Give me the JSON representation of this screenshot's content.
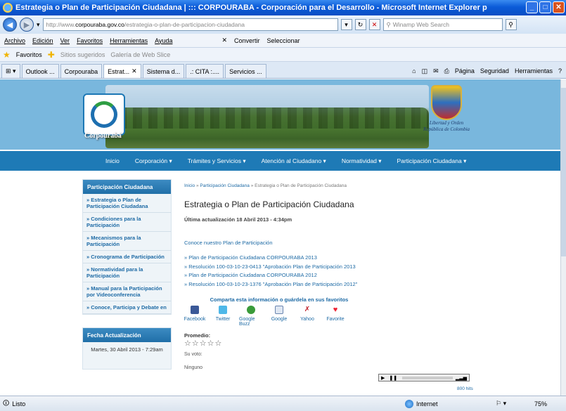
{
  "window": {
    "title": "Estrategia o Plan de Participación Ciudadana | ::: CORPOURABA - Corporación para el Desarrollo - Microsoft Internet Explorer p",
    "url_prefix": "http://www.",
    "url_domain": "corpouraba.gov.co",
    "url_path": "/estrategia-o-plan-de-participacion-ciudadana",
    "search_placeholder": "Winamp Web Search"
  },
  "menubar": [
    "Archivo",
    "Edición",
    "Ver",
    "Favoritos",
    "Herramientas",
    "Ayuda"
  ],
  "convert": {
    "convertir": "Convertir",
    "seleccionar": "Seleccionar"
  },
  "favbar": {
    "favoritos": "Favoritos",
    "sitios": "Sitios sugeridos",
    "galeria": "Galería de Web Slice"
  },
  "tabs": [
    "Outlook ...",
    "Corpouraba",
    "Estrat...",
    "Sistema d...",
    ".: CITA :....",
    "Servicios ..."
  ],
  "tools": [
    "Página",
    "Seguridad",
    "Herramientas"
  ],
  "site": {
    "logo_text": "Corpourabá",
    "shield_line1": "Libertad y Orden",
    "shield_line2": "República de Colombia",
    "nav": [
      "Inicio",
      "Corporación",
      "Trámites y Servicios",
      "Atención al Ciudadano",
      "Normatividad",
      "Participación Ciudadana"
    ]
  },
  "sidebar": {
    "title": "Participación Ciudadana",
    "items": [
      "Estrategia o Plan de Participación Ciudadana",
      "Condiciones para la Participación",
      "Mecanismos para la Participación",
      "Cronograma de Participación",
      "Normatividad para la Participación",
      "Manual para la Participación por Videoconferencia",
      "Conoce, Participa y Debate en"
    ],
    "date_title": "Fecha Actualización",
    "date_value": "Martes, 30 Abril 2013 - 7:29am"
  },
  "content": {
    "crumb_home": "Inicio",
    "crumb_mid": "Participación Ciudadana",
    "crumb_current": "Estrategia o Plan de Participación Ciudadana",
    "title": "Estrategia o Plan de Participación Ciudadana",
    "updated": "Última actualización 18 Abril 2013 - 4:34pm",
    "intro": "Conoce nuestro Plan de Participación",
    "links": [
      "Plan de Participación Ciudadana CORPOURABA 2013",
      "Resolución 100-03-10-23-0413 \"Aprobación Plan de Participación 2013",
      "Plan de Participación Ciudadana CORPOURABA 2012",
      "Resolución 100-03-10-23-1376 \"Aprobación Plan de Participación 2012\""
    ],
    "share_title": "Comparta esta información o guárdela en sus favoritos",
    "share": [
      "Facebook",
      "Twitter",
      "Google Buzz",
      "Google",
      "Yahoo",
      "Favorite"
    ],
    "promedio": "Promedio:",
    "stars": "☆☆☆☆☆",
    "su_voto": "Su voto:",
    "ninguno": "Ninguno",
    "hits": "800 hits"
  },
  "statusbar": {
    "status": "Listo",
    "zone": "Internet",
    "zoom": "75%"
  }
}
